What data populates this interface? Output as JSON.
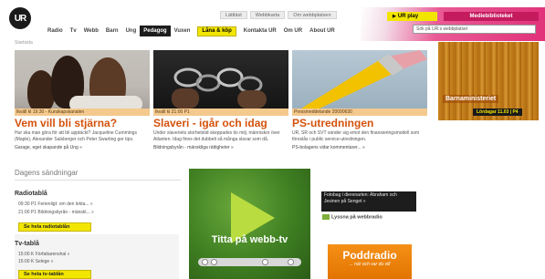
{
  "header": {
    "logo_text": "UR",
    "top_links": [
      "Lättläst",
      "Webbkarta",
      "Om webbplatsen"
    ],
    "ur_play_label": "UR play",
    "mediebiblioteket_label": "Mediebiblioteket",
    "search_placeholder": "Sök på UR:s webbplatser",
    "accent_color": "#f2e600",
    "pink_color": "#c41a5e"
  },
  "nav": {
    "items": [
      "Radio",
      "Tv",
      "Webb",
      "Barn",
      "Ung",
      "Pedagog",
      "Vuxen"
    ],
    "active": "Pedagog",
    "lana_label": "Låna & köp",
    "links": [
      "Kontakta UR",
      "Om UR",
      "About UR"
    ]
  },
  "breadcrumb": "Startsida",
  "news": [
    {
      "meta": "Ikväll kl 19:30 - Kunskapskanalen",
      "title": "Vem vill bli stjärna?",
      "desc": "Hur ska man göra för att bli upptäckt? Jacqueline Cummings (Maple), Alexander Salsberger och Peter Swarting ger tips.",
      "link": "Garage, eget skapande på Ung »"
    },
    {
      "meta": "Ikväll kl 21:00 P1",
      "title": "Slaveri - igår och idag",
      "desc": "Under slaveriets storhetstid skeppades tio milj. människor över Atlanten. Idag finns det dubbelt så många slavar som då.",
      "link": "Bildningsbyrån - mänskliga rättigheter »"
    },
    {
      "meta": "Pressmeddelande 20090630",
      "title": "PS-utredningen",
      "desc": "UR, SR och SVT vänder sig emot den finansieringsmodell som föreslås i public service-utredningen.",
      "link": "PS-bolagens vidar kommentarer... »"
    }
  ],
  "barn": {
    "title": "Barnaministeriet",
    "schedule": "Lördagar 11.03 | P4"
  },
  "today": {
    "heading": "Dagens sändningar",
    "radio_heading": "Radiotablå",
    "radio_rows": [
      "09:30 P1 Ferienligt: om den lekta... »",
      "21:00 P1 Bildningsbyrån - mänskl... »"
    ],
    "radio_button": "Se hela radiotablån",
    "tv_heading": "Tv-tablå",
    "tv_rows": [
      "15:00 K Författarenshal »",
      "15:00 K Selege »"
    ],
    "tv_button": "Se hela tv-tablån"
  },
  "webbtv": {
    "caption": "Titta på webb-tv"
  },
  "snippet": {
    "text": "Fotobag i dierenarten: Abraham och Jesinen på Senget »",
    "link": "Lyssna på webbradio"
  },
  "poddradio": {
    "title": "Poddradio",
    "subtitle": "... när och var du vill"
  }
}
